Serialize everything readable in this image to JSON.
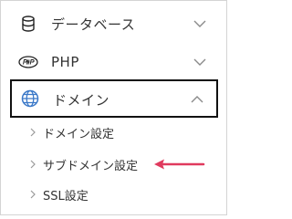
{
  "menu": {
    "items": [
      {
        "label": "データベース",
        "icon": "database-icon",
        "chevron": "chevron-down-icon",
        "expanded": false
      },
      {
        "label": "PHP",
        "icon": "php-icon",
        "chevron": "chevron-down-icon",
        "expanded": false
      },
      {
        "label": "ドメイン",
        "icon": "globe-icon",
        "chevron": "chevron-up-icon",
        "expanded": true,
        "highlighted": true
      }
    ],
    "subitems": [
      {
        "label": "ドメイン設定",
        "icon": "chevron-right-icon"
      },
      {
        "label": "サブドメイン設定",
        "icon": "chevron-right-icon",
        "annotated": true
      },
      {
        "label": "SSL設定",
        "icon": "chevron-right-icon"
      }
    ]
  },
  "colors": {
    "icon_blue": "#3a78c8",
    "text": "#333333",
    "chevron": "#8a8a8a",
    "annotation_arrow": "#e03a5e",
    "highlight_border": "#111111",
    "frame_border": "#d4d4d4"
  }
}
